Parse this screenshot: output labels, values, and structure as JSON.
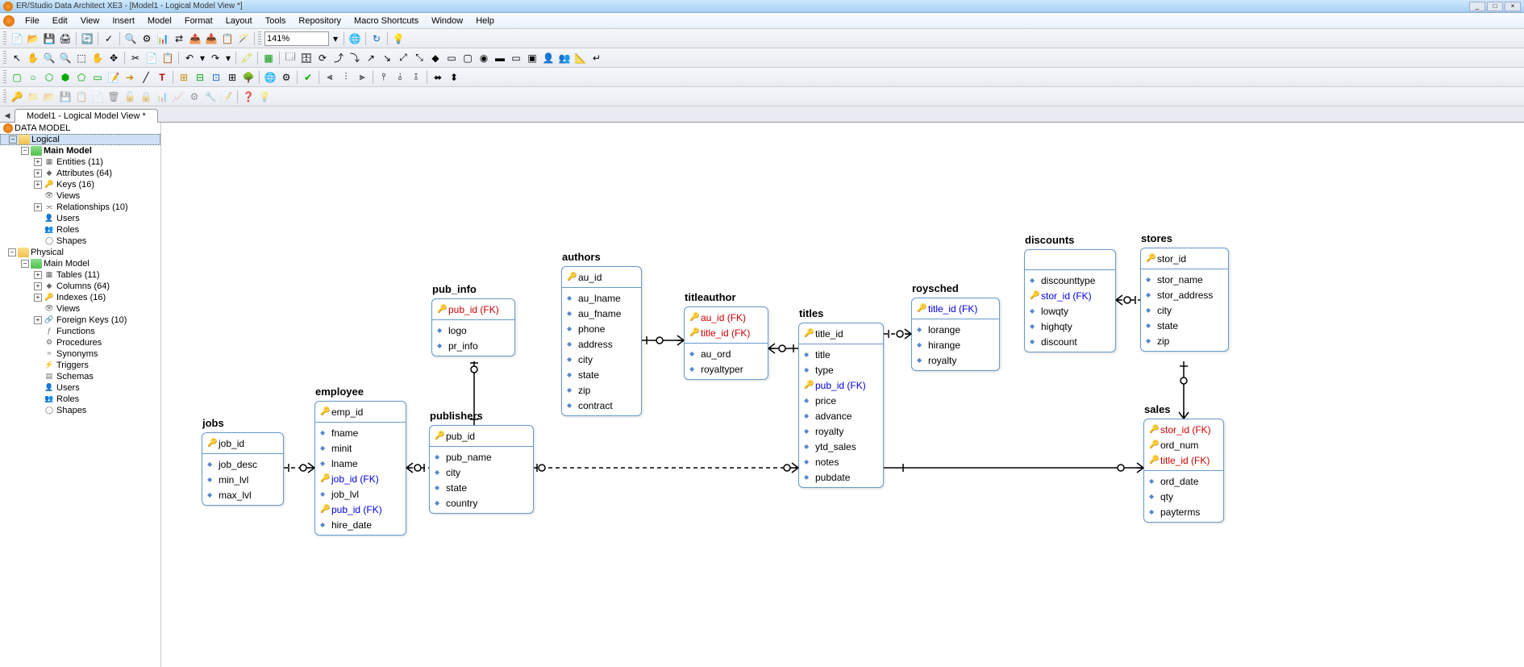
{
  "app": {
    "title": "ER/Studio Data Architect XE3 - [Model1 - Logical Model View *]"
  },
  "menu": {
    "file": "File",
    "edit": "Edit",
    "view": "View",
    "insert": "Insert",
    "model": "Model",
    "format": "Format",
    "layout": "Layout",
    "tools": "Tools",
    "repository": "Repository",
    "macro": "Macro Shortcuts",
    "window": "Window",
    "help": "Help"
  },
  "toolbar": {
    "zoom": "141%"
  },
  "tab": {
    "label": "Model1 - Logical Model View *"
  },
  "tree": {
    "root": "DATA MODEL",
    "logical": "Logical",
    "main_model": "Main Model",
    "entities": "Entities (11)",
    "attributes": "Attributes (64)",
    "keys": "Keys (16)",
    "views_l": "Views",
    "relationships": "Relationships (10)",
    "users_l": "Users",
    "roles_l": "Roles",
    "shapes_l": "Shapes",
    "physical": "Physical",
    "main_model_p": "Main Model",
    "tables": "Tables (11)",
    "columns": "Columns (64)",
    "indexes": "Indexes (16)",
    "views_p": "Views",
    "foreign_keys": "Foreign Keys (10)",
    "functions": "Functions",
    "procedures": "Procedures",
    "synonyms": "Synonyms",
    "triggers": "Triggers",
    "schemas": "Schemas",
    "users_p": "Users",
    "roles_p": "Roles",
    "shapes_p": "Shapes"
  },
  "entities": {
    "jobs": {
      "name": "jobs",
      "pk": [
        "job_id"
      ],
      "attrs": [
        "job_desc",
        "min_lvl",
        "max_lvl"
      ]
    },
    "employee": {
      "name": "employee",
      "pk": [
        "emp_id"
      ],
      "attrs": [
        "fname",
        "minit",
        "lname"
      ],
      "fks": [
        "job_id (FK)"
      ],
      "attrs2": [
        "job_lvl"
      ],
      "fks2": [
        "pub_id (FK)"
      ],
      "attrs3": [
        "hire_date"
      ]
    },
    "pub_info": {
      "name": "pub_info",
      "pk_fk": [
        "pub_id (FK)"
      ],
      "attrs": [
        "logo",
        "pr_info"
      ]
    },
    "publishers": {
      "name": "publishers",
      "pk": [
        "pub_id"
      ],
      "attrs": [
        "pub_name",
        "city",
        "state",
        "country"
      ]
    },
    "authors": {
      "name": "authors",
      "pk": [
        "au_id"
      ],
      "attrs": [
        "au_lname",
        "au_fname",
        "phone",
        "address",
        "city",
        "state",
        "zip",
        "contract"
      ]
    },
    "titleauthor": {
      "name": "titleauthor",
      "pk_fk": [
        "au_id (FK)",
        "title_id (FK)"
      ],
      "attrs": [
        "au_ord",
        "royaltyper"
      ]
    },
    "titles": {
      "name": "titles",
      "pk": [
        "title_id"
      ],
      "attrs": [
        "title",
        "type"
      ],
      "fks": [
        "pub_id (FK)"
      ],
      "attrs2": [
        "price",
        "advance",
        "royalty",
        "ytd_sales",
        "notes",
        "pubdate"
      ]
    },
    "roysched": {
      "name": "roysched",
      "fks": [
        "title_id (FK)"
      ],
      "attrs": [
        "lorange",
        "hirange",
        "royalty"
      ]
    },
    "discounts": {
      "name": "discounts",
      "attrs1": [
        "discounttype"
      ],
      "fks": [
        "stor_id (FK)"
      ],
      "attrs2": [
        "lowqty",
        "highqty",
        "discount"
      ]
    },
    "stores": {
      "name": "stores",
      "pk": [
        "stor_id"
      ],
      "attrs": [
        "stor_name",
        "stor_address",
        "city",
        "state",
        "zip"
      ]
    },
    "sales": {
      "name": "sales",
      "pk_fk1": [
        "stor_id (FK)"
      ],
      "pk": [
        "ord_num"
      ],
      "pk_fk2": [
        "title_id (FK)"
      ],
      "attrs": [
        "ord_date",
        "qty",
        "payterms"
      ]
    }
  }
}
